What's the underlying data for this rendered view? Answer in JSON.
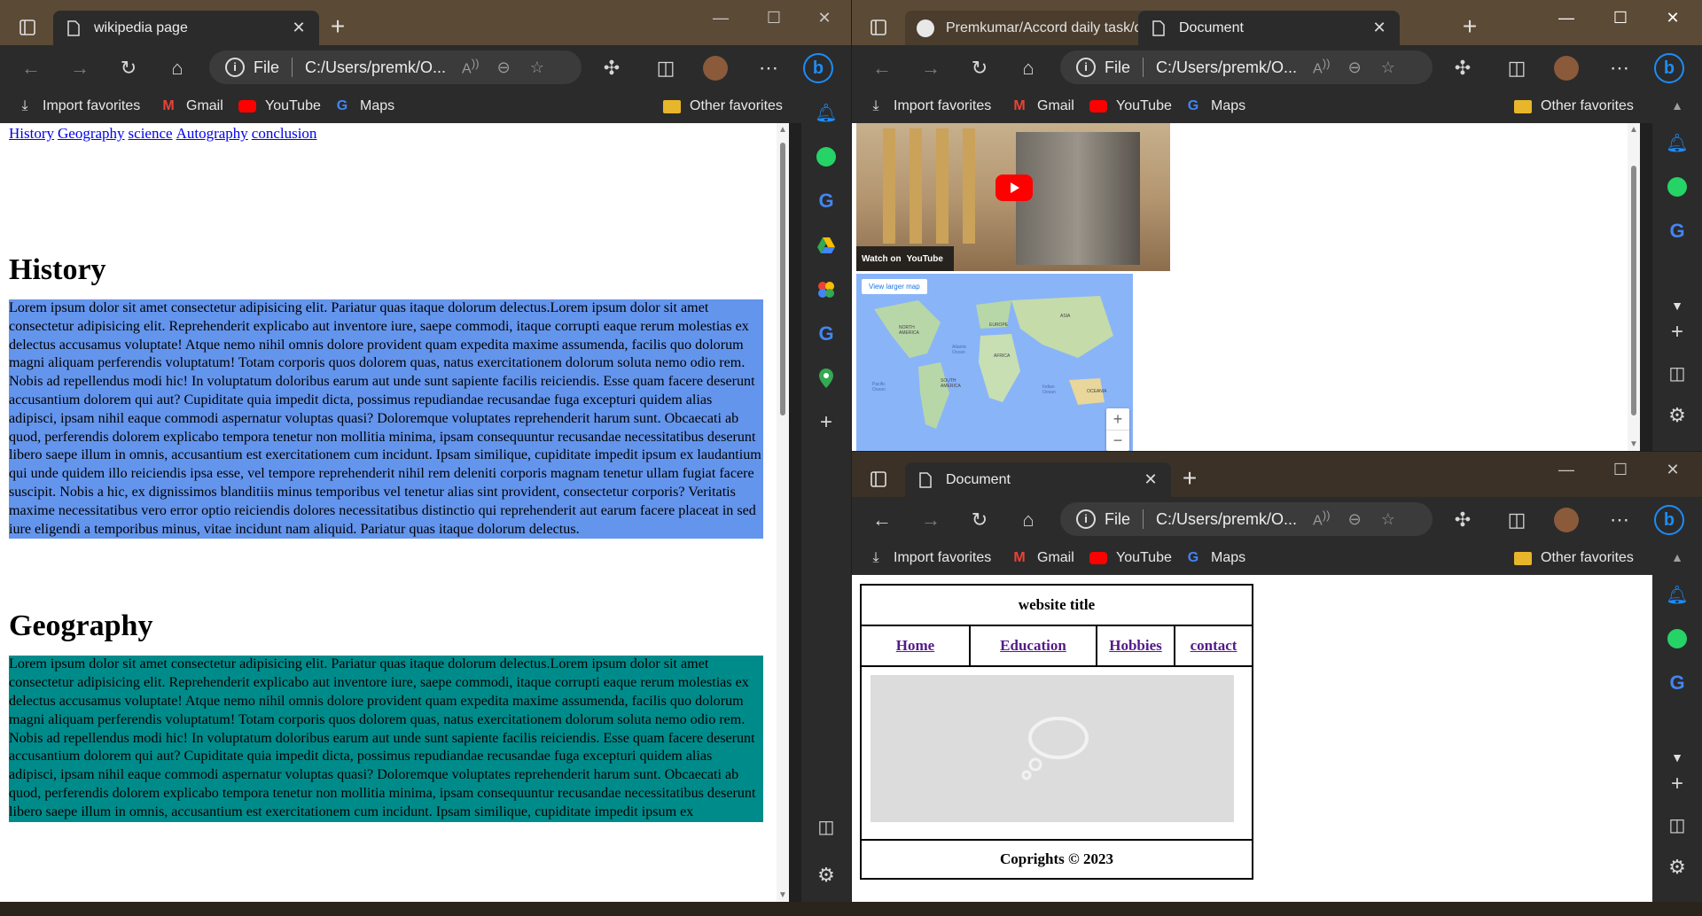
{
  "left_window": {
    "tab_title": "wikipedia page",
    "address": "C:/Users/premk/O...",
    "address_scheme": "File",
    "nav_links": [
      "History",
      "Geography",
      "science",
      "Autography",
      "conclusion"
    ],
    "sections": [
      {
        "heading": "History",
        "bg_color": "#6495ed",
        "text": "Lorem ipsum dolor sit amet consectetur adipisicing elit. Pariatur quas itaque dolorum delectus.Lorem ipsum dolor sit amet consectetur adipisicing elit. Reprehenderit explicabo aut inventore iure, saepe commodi, itaque corrupti eaque rerum molestias ex delectus accusamus voluptate! Atque nemo nihil omnis dolore provident quam expedita maxime assumenda, facilis quo dolorum magni aliquam perferendis voluptatum! Totam corporis quos dolorem quas, natus exercitationem dolorum soluta nemo odio rem. Nobis ad repellendus modi hic! In voluptatum doloribus earum aut unde sunt sapiente facilis reiciendis. Esse quam facere deserunt accusantium dolorem qui aut? Cupiditate quia impedit dicta, possimus repudiandae recusandae fuga excepturi quidem alias adipisci, ipsam nihil eaque commodi aspernatur voluptas quasi? Doloremque voluptates reprehenderit harum sunt. Obcaecati ab quod, perferendis dolorem explicabo tempora tenetur non mollitia minima, ipsam consequuntur recusandae necessitatibus deserunt libero saepe illum in omnis, accusantium est exercitationem cum incidunt. Ipsam similique, cupiditate impedit ipsum ex laudantium qui unde quidem illo reiciendis ipsa esse, vel tempore reprehenderit nihil rem deleniti corporis magnam tenetur ullam fugiat facere suscipit. Nobis a hic, ex dignissimos blanditiis minus temporibus vel tenetur alias sint provident, consectetur corporis? Veritatis maxime necessitatibus vero error optio reiciendis dolores necessitatibus distinctio qui reprehenderit aut earum facere placeat in sed iure eligendi a temporibus minus, vitae incidunt nam aliquid. Pariatur quas itaque dolorum delectus."
      },
      {
        "heading": "Geography",
        "bg_color": "#008b8b",
        "text": "Lorem ipsum dolor sit amet consectetur adipisicing elit. Pariatur quas itaque dolorum delectus.Lorem ipsum dolor sit amet consectetur adipisicing elit. Reprehenderit explicabo aut inventore iure, saepe commodi, itaque corrupti eaque rerum molestias ex delectus accusamus voluptate! Atque nemo nihil omnis dolore provident quam expedita maxime assumenda, facilis quo dolorum magni aliquam perferendis voluptatum! Totam corporis quos dolorem quas, natus exercitationem dolorum soluta nemo odio rem. Nobis ad repellendus modi hic! In voluptatum doloribus earum aut unde sunt sapiente facilis reiciendis. Esse quam facere deserunt accusantium dolorem qui aut? Cupiditate quia impedit dicta, possimus repudiandae recusandae fuga excepturi quidem alias adipisci, ipsam nihil eaque commodi aspernatur voluptas quasi? Doloremque voluptates reprehenderit harum sunt. Obcaecati ab quod, perferendis dolorem explicabo tempora tenetur non mollitia minima, ipsam consequuntur recusandae necessitatibus deserunt libero saepe illum in omnis, accusantium est exercitationem cum incidunt. Ipsam similique, cupiditate impedit ipsum ex"
      }
    ]
  },
  "right_top_window": {
    "tabs": [
      "Premkumar/Accord daily task/da",
      "Document"
    ],
    "address": "C:/Users/premk/O...",
    "address_scheme": "File",
    "video_watch_on": "Watch on",
    "video_platform": "YouTube",
    "map_link": "View larger map",
    "map_zoom_in": "+",
    "map_zoom_out": "−",
    "map_labels": [
      "NORTH AMERICA",
      "EUROPE",
      "ASIA",
      "AFRICA",
      "SOUTH AMERICA",
      "Atlantic Ocean",
      "Pacific Ocean",
      "Indian Ocean",
      "OCEANIA"
    ]
  },
  "right_bottom_window": {
    "tab_title": "Document",
    "address": "C:/Users/premk/O...",
    "address_scheme": "File",
    "site_title": "website title",
    "nav": [
      "Home",
      "Education",
      "Hobbies",
      "contact"
    ],
    "footer": "Coprights © 2023"
  },
  "bookmarks": {
    "import": "Import favorites",
    "gmail": "Gmail",
    "youtube": "YouTube",
    "maps": "Maps",
    "other": "Other favorites"
  },
  "colors": {
    "titlebar": "#5b4a35",
    "toolbar": "#2b2b2b",
    "history_bg": "#6495ed",
    "geography_bg": "#008b8b",
    "edge_accent": "#1d8cf8"
  }
}
